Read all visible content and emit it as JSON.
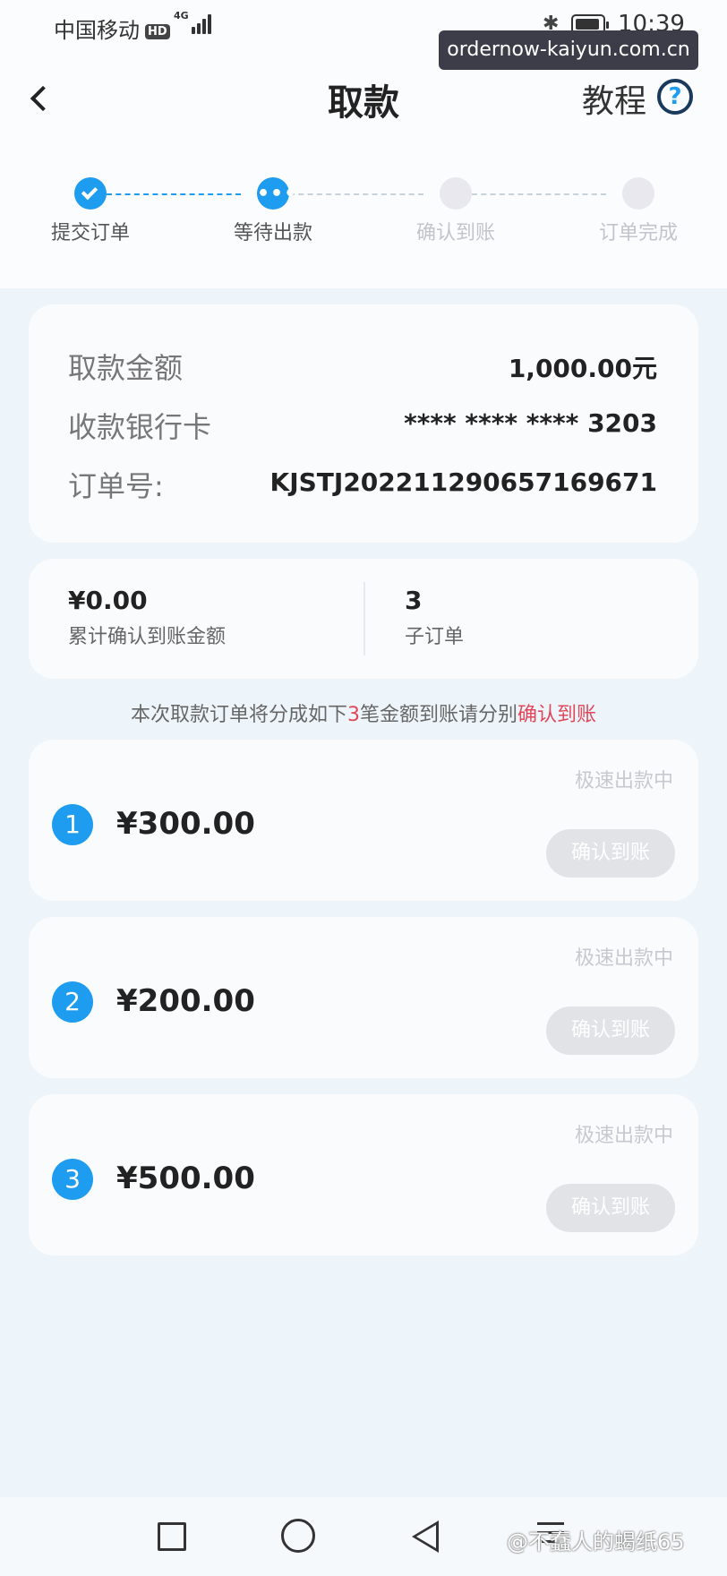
{
  "status_bar": {
    "carrier": "中国移动",
    "hd": "HD",
    "network": "4G",
    "time": "10:39"
  },
  "overlay_url": "ordernow-kaiyun.com.cn",
  "header": {
    "title": "取款",
    "tutorial": "教程",
    "help_glyph": "?"
  },
  "steps": [
    {
      "label": "提交订单",
      "state": "done"
    },
    {
      "label": "等待出款",
      "state": "current",
      "glyph": "•••"
    },
    {
      "label": "确认到账",
      "state": "pending"
    },
    {
      "label": "订单完成",
      "state": "pending"
    }
  ],
  "details": {
    "amount_label": "取款金额",
    "amount_value": "1,000.00元",
    "card_label": "收款银行卡",
    "card_value": "**** **** **** 3203",
    "order_label": "订单号:",
    "order_value": "KJSTJ2022112906571696​71"
  },
  "summary": {
    "confirmed_value": "¥0.00",
    "confirmed_label": "累计确认到账金额",
    "suborders_value": "3",
    "suborders_label": "子订单"
  },
  "notice": {
    "part1": "本次取款订单将分成如下",
    "count": "3",
    "part2": "笔金额到账请分别",
    "highlight": "确认到账"
  },
  "orders": [
    {
      "index": "1",
      "amount": "¥300.00",
      "status": "极速出款中",
      "button": "确认到账"
    },
    {
      "index": "2",
      "amount": "¥200.00",
      "status": "极速出款中",
      "button": "确认到账"
    },
    {
      "index": "3",
      "amount": "¥500.00",
      "status": "极速出款中",
      "button": "确认到账"
    }
  ],
  "watermark": "@不蠢人的蝎纸65",
  "colors": {
    "accent": "#1e9cf0",
    "highlight_red": "#e0475a",
    "disabled_button": "#e2e3e7"
  },
  "icons": {
    "back": "chevron-left-icon",
    "help": "question-circle-icon",
    "nav_recent": "square-icon",
    "nav_home": "circle-icon",
    "nav_back": "triangle-back-icon",
    "nav_menu": "menu-icon"
  }
}
